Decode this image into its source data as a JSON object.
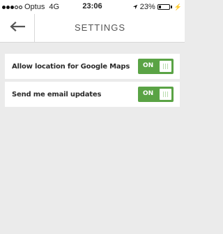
{
  "status_bar": {
    "carrier": "Optus",
    "network": "4G",
    "time": "23:06",
    "battery_percent_label": "23%",
    "battery_level": 0.23,
    "signal_bars_filled": 3,
    "signal_bars_total": 5,
    "icons": [
      "location-arrow-icon",
      "battery-icon",
      "charging-bolt-icon"
    ]
  },
  "header": {
    "back_icon": "back-arrow-icon",
    "title": "SETTINGS"
  },
  "settings": [
    {
      "label": "Allow location for Google Maps",
      "toggle_label": "ON",
      "enabled": true
    },
    {
      "label": "Send me email updates",
      "toggle_label": "ON",
      "enabled": true
    }
  ],
  "colors": {
    "toggle_on": "#5aa345",
    "background": "#ebebeb",
    "card": "#ffffff"
  }
}
